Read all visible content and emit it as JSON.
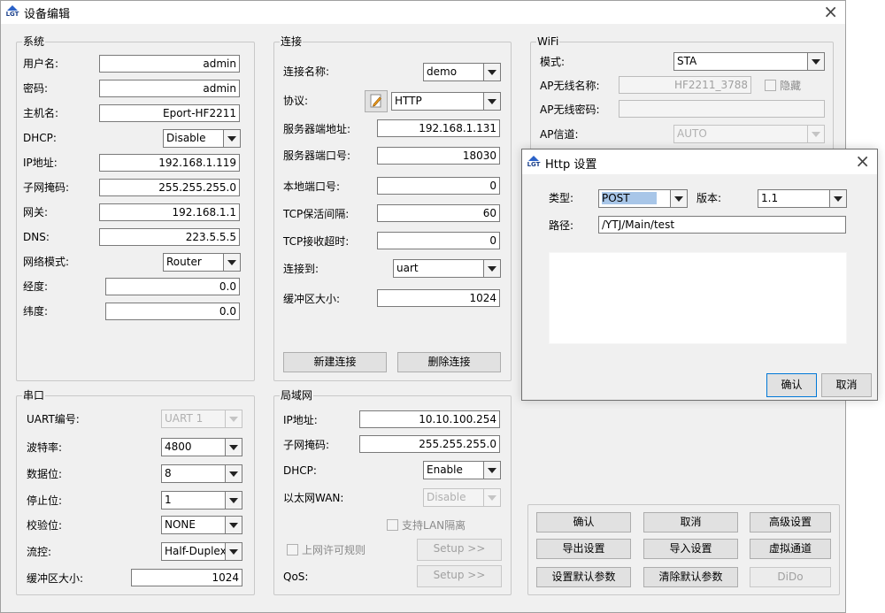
{
  "window": {
    "title": "设备编辑"
  },
  "system": {
    "title": "系统",
    "username_label": "用户名:",
    "username": "admin",
    "password_label": "密码:",
    "password": "admin",
    "hostname_label": "主机名:",
    "hostname": "Eport-HF2211",
    "dhcp_label": "DHCP:",
    "dhcp": "Disable",
    "ip_label": "IP地址:",
    "ip": "192.168.1.119",
    "mask_label": "子网掩码:",
    "mask": "255.255.255.0",
    "gateway_label": "网关:",
    "gateway": "192.168.1.1",
    "dns_label": "DNS:",
    "dns": "223.5.5.5",
    "netmode_label": "网络模式:",
    "netmode": "Router",
    "longitude_label": "经度:",
    "longitude": "0.0",
    "latitude_label": "纬度:",
    "latitude": "0.0"
  },
  "connection": {
    "title": "连接",
    "name_label": "连接名称:",
    "name": "demo",
    "protocol_label": "协议:",
    "protocol": "HTTP",
    "server_addr_label": "服务器端地址:",
    "server_addr": "192.168.1.131",
    "server_port_label": "服务器端口号:",
    "server_port": "18030",
    "local_port_label": "本地端口号:",
    "local_port": "0",
    "keepalive_label": "TCP保活间隔:",
    "keepalive": "60",
    "timeout_label": "TCP接收超时:",
    "timeout": "0",
    "connect_to_label": "连接到:",
    "connect_to": "uart",
    "buffer_label": "缓冲区大小:",
    "buffer": "1024",
    "new_button": "新建连接",
    "delete_button": "删除连接"
  },
  "wifi": {
    "title": "WiFi",
    "mode_label": "模式:",
    "mode": "STA",
    "ap_name_label": "AP无线名称:",
    "ap_name": "HF2211_3788",
    "hide_label": "隐藏",
    "ap_password_label": "AP无线密码:",
    "ap_password": "",
    "ap_channel_label": "AP信道:",
    "ap_channel": "AUTO"
  },
  "serial": {
    "title": "串口",
    "uart_label": "UART编号:",
    "uart": "UART 1",
    "baud_label": "波特率:",
    "baud": "4800",
    "databits_label": "数据位:",
    "databits": "8",
    "stopbits_label": "停止位:",
    "stopbits": "1",
    "parity_label": "校验位:",
    "parity": "NONE",
    "flow_label": "流控:",
    "flow": "Half-Duplex",
    "buffer_label": "缓冲区大小:",
    "buffer": "1024"
  },
  "lan": {
    "title": "局域网",
    "ip_label": "IP地址:",
    "ip": "10.10.100.254",
    "mask_label": "子网掩码:",
    "mask": "255.255.255.0",
    "dhcp_label": "DHCP:",
    "dhcp": "Enable",
    "wan_label": "以太网WAN:",
    "wan": "Disable",
    "lan_isolate_label": "支持LAN隔离",
    "internet_rule_label": "上网许可规则",
    "setup_button": "Setup >>",
    "qos_label": "QoS:",
    "qos_setup_button": "Setup >>"
  },
  "actions": {
    "ok": "确认",
    "cancel": "取消",
    "advanced": "高级设置",
    "export": "导出设置",
    "import": "导入设置",
    "virtual_channel": "虚拟通道",
    "set_default": "设置默认参数",
    "clear_default": "清除默认参数",
    "dido": "DiDo"
  },
  "http_dialog": {
    "title": "Http 设置",
    "type_label": "类型:",
    "type": "POST",
    "version_label": "版本:",
    "version": "1.1",
    "path_label": "路径:",
    "path": "/YTJ/Main/test",
    "ok": "确认",
    "cancel": "取消"
  },
  "colors": {
    "window_bg": "#f0f0f0",
    "selection": "#a8c6e8",
    "focus_border": "#0078d7"
  }
}
